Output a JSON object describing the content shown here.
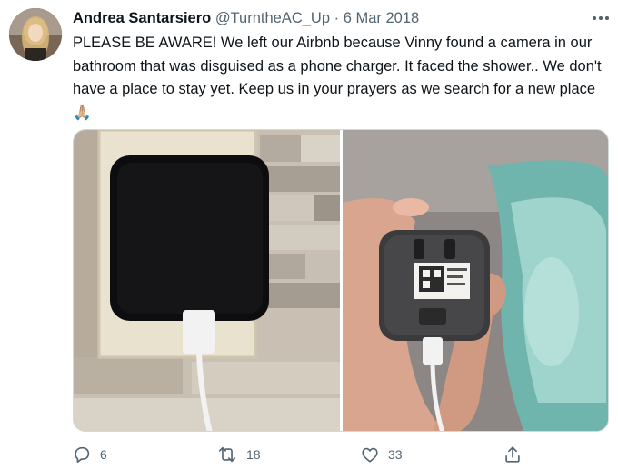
{
  "tweet": {
    "author_name": "Andrea Santarsiero",
    "handle": "@TurntheAC_Up",
    "separator": " · ",
    "date": "6 Mar 2018",
    "text": "PLEASE BE AWARE! We left our Airbnb because Vinny found a camera in our bathroom that was disguised as a phone charger. It faced the shower.. We don't have a place to stay yet. Keep us in your prayers as we search for a new place🙏🏼"
  },
  "actions": {
    "reply_count": "6",
    "retweet_count": "18",
    "like_count": "33"
  },
  "icons": {
    "more": "more-dots-icon",
    "reply": "reply-icon",
    "retweet": "retweet-icon",
    "like": "heart-icon",
    "share": "share-icon"
  },
  "colors": {
    "text": "#0f1419",
    "secondary": "#536471",
    "border": "#cfd9de"
  }
}
